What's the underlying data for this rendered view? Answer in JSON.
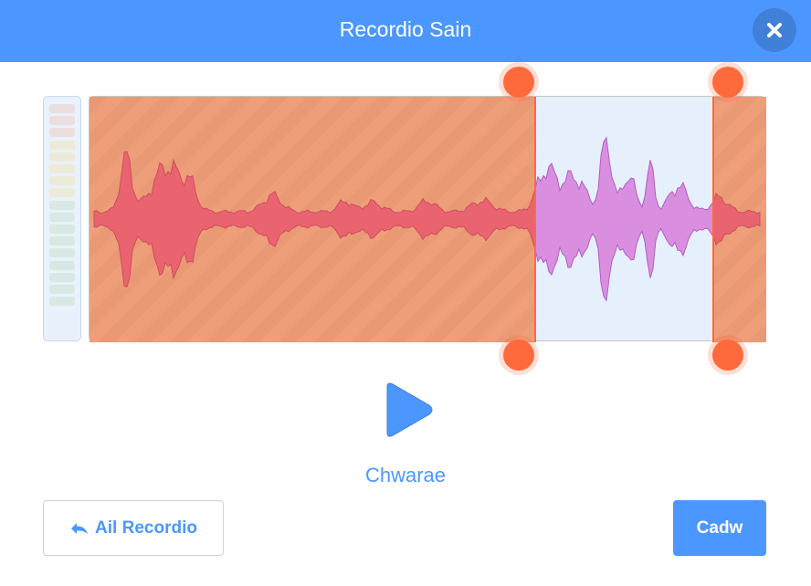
{
  "header": {
    "title": "Recordio Sain",
    "close_icon": "close-icon"
  },
  "colors": {
    "accent": "#4c97ff",
    "handle": "#ff6a3c",
    "trimmed_overlay": "#ef9e7a",
    "waveform_trimmed": "#ea5e70",
    "waveform_selected": "#d98ee0",
    "selection_background": "#e6f0fc"
  },
  "level_meter": {
    "icon": "level-meter",
    "bar_count": 17
  },
  "waveform": {
    "trim_start_fraction": 0.658,
    "trim_end_fraction": 0.922
  },
  "playback": {
    "play_icon": "play-icon",
    "label": "Chwarae"
  },
  "footer": {
    "rerecord_label": "Ail Recordio",
    "rerecord_icon": "undo-arrow-icon",
    "save_label": "Cadw"
  }
}
